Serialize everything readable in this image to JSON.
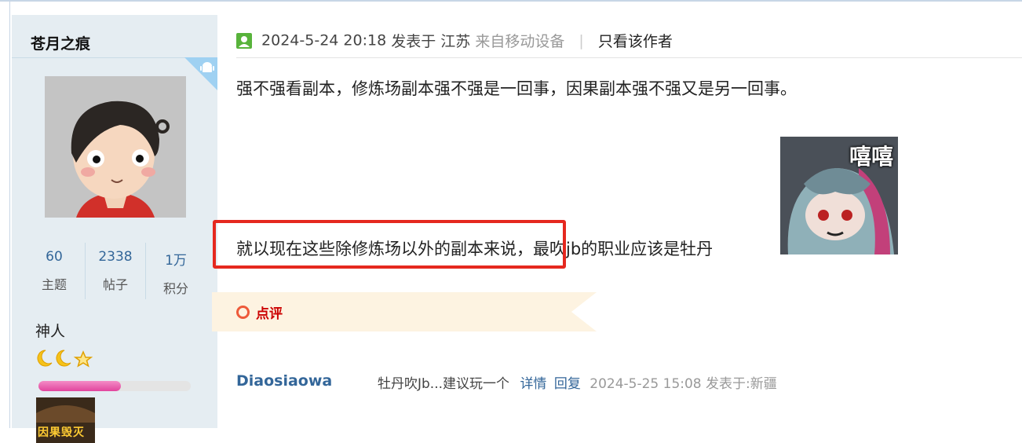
{
  "sidebar": {
    "username": "苍月之痕",
    "stats": [
      {
        "value": "60",
        "label": "主题"
      },
      {
        "value": "2338",
        "label": "帖子"
      },
      {
        "value": "1万",
        "label": "积分"
      }
    ],
    "rank": "神人",
    "level_progress": 0.54,
    "medal_text": "因果毁灭",
    "icons": [
      "android-icon",
      "avatar-image",
      "moon-star-rank-icons",
      "medal-badge"
    ]
  },
  "post": {
    "datetime": "2024-5-24 20:18",
    "posted_at": "发表于",
    "location": "江苏",
    "device": "来自移动设备",
    "separator": "|",
    "only_author": "只看该作者",
    "paragraph1": "强不强看副本，修炼场副本强不强是一回事，因果副本强不强又是另一回事。",
    "paragraph2_a": "就以现在这些除修炼场以外的副本来说，",
    "paragraph2_b": "最吹jb的职业应该是牡丹",
    "sticker_text": "嘻嘻"
  },
  "review": {
    "label": "点评"
  },
  "comment": {
    "user": "Diaosiaowa",
    "text": "牡丹吹Jb...建议玩一个",
    "detail_link": "详情",
    "reply_link": "回复",
    "meta": "2024-5-25 15:08 发表于:新疆"
  },
  "colors": {
    "sidebar_bg": "#e5edf2",
    "link": "#336699",
    "highlight_box": "#e5281f",
    "review_bg": "#fdf3e1"
  }
}
